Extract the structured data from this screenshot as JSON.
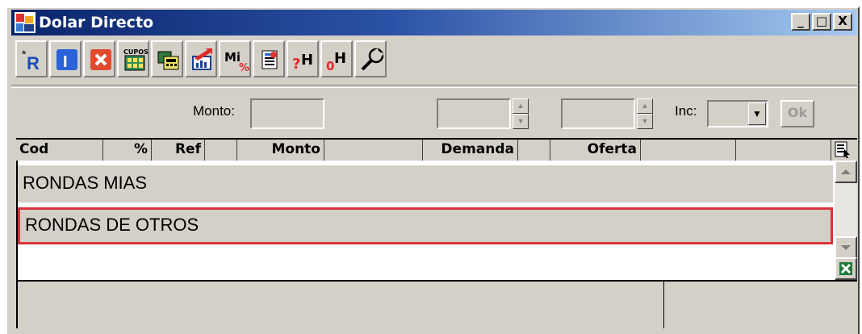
{
  "window": {
    "title": "Dolar Directo",
    "minimize_label": "_",
    "maximize_label": "□",
    "close_label": "X"
  },
  "toolbar": {
    "buttons": [
      {
        "name": "new-r-icon",
        "label": "R"
      },
      {
        "name": "info-icon",
        "label": "I"
      },
      {
        "name": "cancel-icon",
        "label": "X"
      },
      {
        "name": "cupos-icon",
        "label": "CUPOS"
      },
      {
        "name": "calculator-icon",
        "label": ""
      },
      {
        "name": "chart-icon",
        "label": ""
      },
      {
        "name": "mi-percent-icon",
        "label": "Mi"
      },
      {
        "name": "book-icon",
        "label": ""
      },
      {
        "name": "help-h-icon",
        "label": "H"
      },
      {
        "name": "zero-h-icon",
        "label": "H"
      },
      {
        "name": "wrench-icon",
        "label": ""
      }
    ]
  },
  "filters": {
    "monto_label": "Monto:",
    "monto_value": "",
    "inc_label": "Inc:",
    "inc_value": "",
    "ok_label": "Ok"
  },
  "columns": [
    "Cod",
    "%",
    "Ref",
    "",
    "Monto",
    "",
    "Demanda",
    "",
    "Oferta",
    "",
    ""
  ],
  "rows": [
    {
      "label": "RONDAS MIAS"
    },
    {
      "label": "RONDAS DE OTROS"
    }
  ],
  "colors": {
    "title_bar": "#0a246a",
    "highlight_border": "#d9343a",
    "face": "#d4d0c8"
  }
}
